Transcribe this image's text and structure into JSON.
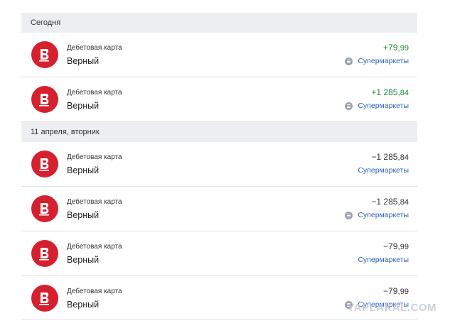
{
  "sections": [
    {
      "title": "Сегодня",
      "rows": [
        {
          "type": "Дебетовая карта",
          "merchant": "Верный",
          "amount_main": "+79,",
          "amount_frac": "99",
          "category": "Супермаркеты",
          "positive": true,
          "show_cat_icon": true
        },
        {
          "type": "Дебетовая карта",
          "merchant": "Верный",
          "amount_main": "+1 285,",
          "amount_frac": "84",
          "category": "Супермаркеты",
          "positive": true,
          "show_cat_icon": true
        }
      ]
    },
    {
      "title": "11 апреля, вторник",
      "rows": [
        {
          "type": "Дебетовая карта",
          "merchant": "Верный",
          "amount_main": "−1 285,",
          "amount_frac": "84",
          "category": "Супермаркеты",
          "positive": false,
          "show_cat_icon": false
        },
        {
          "type": "Дебетовая карта",
          "merchant": "Верный",
          "amount_main": "−1 285,",
          "amount_frac": "84",
          "category": "Супермаркеты",
          "positive": false,
          "show_cat_icon": true
        },
        {
          "type": "Дебетовая карта",
          "merchant": "Верный",
          "amount_main": "−79,",
          "amount_frac": "99",
          "category": "Супермаркеты",
          "positive": false,
          "show_cat_icon": false
        },
        {
          "type": "Дебетовая карта",
          "merchant": "Верный",
          "amount_main": "−79,",
          "amount_frac": "99",
          "category": "Супермаркеты",
          "positive": false,
          "show_cat_icon": true
        }
      ]
    }
  ],
  "watermark": "YAPLAKAL.COM",
  "colors": {
    "brand": "#d5212f",
    "positive": "#1a8b35",
    "link": "#2a62b8",
    "header_bg": "#eceef1"
  },
  "icons": {
    "merchant_logo": "verny-logo-icon",
    "category": "supermarket-category-icon"
  }
}
